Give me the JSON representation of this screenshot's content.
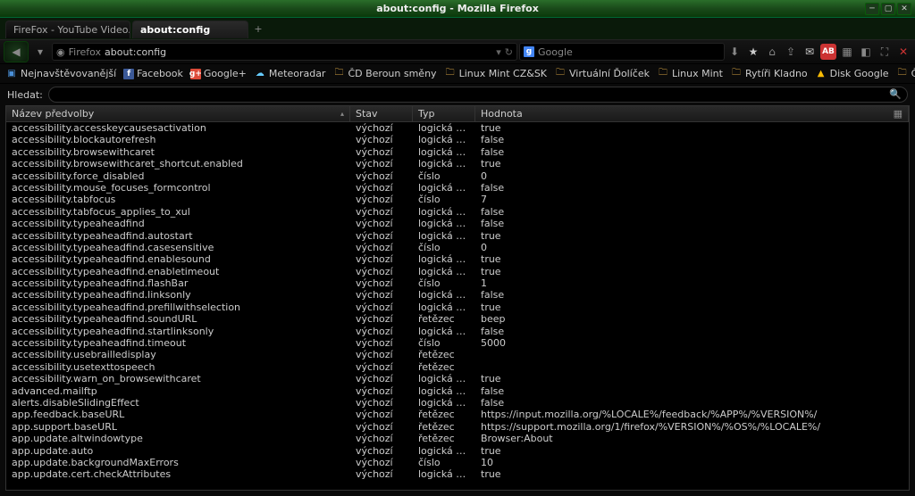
{
  "window": {
    "title": "about:config - Mozilla Firefox"
  },
  "tabs": [
    {
      "label": "FireFox - YouTube Video...",
      "active": false
    },
    {
      "label": "about:config",
      "active": true
    }
  ],
  "nav": {
    "url_prefix": "Firefox",
    "url": "about:config",
    "search_engine": "Google",
    "search_placeholder": ""
  },
  "bookmarks": [
    {
      "label": "Nejnavštěvovanější",
      "icon": "folder-blue"
    },
    {
      "label": "Facebook",
      "icon": "fb"
    },
    {
      "label": "Google+",
      "icon": "gp"
    },
    {
      "label": "Meteoradar",
      "icon": "meteo"
    },
    {
      "label": "ČD Beroun směny",
      "icon": "folder"
    },
    {
      "label": "Linux Mint CZ&SK",
      "icon": "folder"
    },
    {
      "label": "Virtuální Ďolíček",
      "icon": "folder"
    },
    {
      "label": "Linux Mint",
      "icon": "folder"
    },
    {
      "label": "Rytíři Kladno",
      "icon": "folder"
    },
    {
      "label": "Disk Google",
      "icon": "gdrive"
    },
    {
      "label": "ČD Beroun směny",
      "icon": "folder"
    }
  ],
  "search_label": "Hledat:",
  "columns": {
    "name": "Název předvolby",
    "status": "Stav",
    "type": "Typ",
    "value": "Hodnota"
  },
  "type_labels": {
    "bool": "logická hod…",
    "int": "číslo",
    "string": "řetězec"
  },
  "status_default": "výchozí",
  "prefs": [
    {
      "name": "accessibility.accesskeycausesactivation",
      "type": "bool",
      "value": "true"
    },
    {
      "name": "accessibility.blockautorefresh",
      "type": "bool",
      "value": "false"
    },
    {
      "name": "accessibility.browsewithcaret",
      "type": "bool",
      "value": "false"
    },
    {
      "name": "accessibility.browsewithcaret_shortcut.enabled",
      "type": "bool",
      "value": "true"
    },
    {
      "name": "accessibility.force_disabled",
      "type": "int",
      "value": "0"
    },
    {
      "name": "accessibility.mouse_focuses_formcontrol",
      "type": "bool",
      "value": "false"
    },
    {
      "name": "accessibility.tabfocus",
      "type": "int",
      "value": "7"
    },
    {
      "name": "accessibility.tabfocus_applies_to_xul",
      "type": "bool",
      "value": "false"
    },
    {
      "name": "accessibility.typeaheadfind",
      "type": "bool",
      "value": "false"
    },
    {
      "name": "accessibility.typeaheadfind.autostart",
      "type": "bool",
      "value": "true"
    },
    {
      "name": "accessibility.typeaheadfind.casesensitive",
      "type": "int",
      "value": "0"
    },
    {
      "name": "accessibility.typeaheadfind.enablesound",
      "type": "bool",
      "value": "true"
    },
    {
      "name": "accessibility.typeaheadfind.enabletimeout",
      "type": "bool",
      "value": "true"
    },
    {
      "name": "accessibility.typeaheadfind.flashBar",
      "type": "int",
      "value": "1"
    },
    {
      "name": "accessibility.typeaheadfind.linksonly",
      "type": "bool",
      "value": "false"
    },
    {
      "name": "accessibility.typeaheadfind.prefillwithselection",
      "type": "bool",
      "value": "true"
    },
    {
      "name": "accessibility.typeaheadfind.soundURL",
      "type": "string",
      "value": "beep"
    },
    {
      "name": "accessibility.typeaheadfind.startlinksonly",
      "type": "bool",
      "value": "false"
    },
    {
      "name": "accessibility.typeaheadfind.timeout",
      "type": "int",
      "value": "5000"
    },
    {
      "name": "accessibility.usebrailledisplay",
      "type": "string",
      "value": ""
    },
    {
      "name": "accessibility.usetexttospeech",
      "type": "string",
      "value": ""
    },
    {
      "name": "accessibility.warn_on_browsewithcaret",
      "type": "bool",
      "value": "true"
    },
    {
      "name": "advanced.mailftp",
      "type": "bool",
      "value": "false"
    },
    {
      "name": "alerts.disableSlidingEffect",
      "type": "bool",
      "value": "false"
    },
    {
      "name": "app.feedback.baseURL",
      "type": "string",
      "value": "https://input.mozilla.org/%LOCALE%/feedback/%APP%/%VERSION%/"
    },
    {
      "name": "app.support.baseURL",
      "type": "string",
      "value": "https://support.mozilla.org/1/firefox/%VERSION%/%OS%/%LOCALE%/"
    },
    {
      "name": "app.update.altwindowtype",
      "type": "string",
      "value": "Browser:About"
    },
    {
      "name": "app.update.auto",
      "type": "bool",
      "value": "true"
    },
    {
      "name": "app.update.backgroundMaxErrors",
      "type": "int",
      "value": "10"
    },
    {
      "name": "app.update.cert.checkAttributes",
      "type": "bool",
      "value": "true"
    }
  ]
}
